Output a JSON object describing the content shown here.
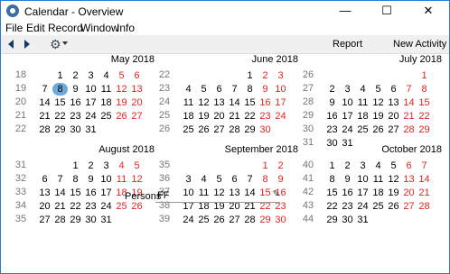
{
  "window": {
    "title": "Calendar - Overview",
    "controls": {
      "minimize": "—",
      "maximize": "☐",
      "close": "✕"
    }
  },
  "menubar": [
    "File",
    "Edit",
    "Record",
    "Window",
    "Info"
  ],
  "toolbar": {
    "report_label": "Report",
    "new_activity_label": "New Activity"
  },
  "colors": {
    "weekend": "#e52321",
    "today": "#6fa8dc",
    "week": "#777777"
  },
  "persons": {
    "label": "Persons",
    "value": "FF"
  },
  "months": [
    {
      "title": "May 2018",
      "today": 8,
      "weeks": [
        {
          "wk": "18",
          "days": [
            "",
            "1",
            "2",
            "3",
            "4",
            "5",
            "6"
          ]
        },
        {
          "wk": "19",
          "days": [
            "7",
            "8",
            "9",
            "10",
            "11",
            "12",
            "13"
          ]
        },
        {
          "wk": "20",
          "days": [
            "14",
            "15",
            "16",
            "17",
            "18",
            "19",
            "20"
          ]
        },
        {
          "wk": "21",
          "days": [
            "21",
            "22",
            "23",
            "24",
            "25",
            "26",
            "27"
          ]
        },
        {
          "wk": "22",
          "days": [
            "28",
            "29",
            "30",
            "31",
            "",
            "",
            ""
          ]
        }
      ]
    },
    {
      "title": "June 2018",
      "weeks": [
        {
          "wk": "22",
          "days": [
            "",
            "",
            "",
            "",
            "1",
            "2",
            "3"
          ]
        },
        {
          "wk": "23",
          "days": [
            "4",
            "5",
            "6",
            "7",
            "8",
            "9",
            "10"
          ]
        },
        {
          "wk": "24",
          "days": [
            "11",
            "12",
            "13",
            "14",
            "15",
            "16",
            "17"
          ]
        },
        {
          "wk": "25",
          "days": [
            "18",
            "19",
            "20",
            "21",
            "22",
            "23",
            "24"
          ]
        },
        {
          "wk": "26",
          "days": [
            "25",
            "26",
            "27",
            "28",
            "29",
            "30",
            ""
          ]
        }
      ]
    },
    {
      "title": "July 2018",
      "weeks": [
        {
          "wk": "26",
          "days": [
            "",
            "",
            "",
            "",
            "",
            "",
            "1"
          ]
        },
        {
          "wk": "27",
          "days": [
            "2",
            "3",
            "4",
            "5",
            "6",
            "7",
            "8"
          ]
        },
        {
          "wk": "28",
          "days": [
            "9",
            "10",
            "11",
            "12",
            "13",
            "14",
            "15"
          ]
        },
        {
          "wk": "29",
          "days": [
            "16",
            "17",
            "18",
            "19",
            "20",
            "21",
            "22"
          ]
        },
        {
          "wk": "30",
          "days": [
            "23",
            "24",
            "25",
            "26",
            "27",
            "28",
            "29"
          ]
        },
        {
          "wk": "31",
          "days": [
            "30",
            "31",
            "",
            "",
            "",
            "",
            ""
          ]
        }
      ]
    },
    {
      "title": "August 2018",
      "weeks": [
        {
          "wk": "31",
          "days": [
            "",
            "",
            "1",
            "2",
            "3",
            "4",
            "5"
          ]
        },
        {
          "wk": "32",
          "days": [
            "6",
            "7",
            "8",
            "9",
            "10",
            "11",
            "12"
          ]
        },
        {
          "wk": "33",
          "days": [
            "13",
            "14",
            "15",
            "16",
            "17",
            "18",
            "19"
          ]
        },
        {
          "wk": "34",
          "days": [
            "20",
            "21",
            "22",
            "23",
            "24",
            "25",
            "26"
          ]
        },
        {
          "wk": "35",
          "days": [
            "27",
            "28",
            "29",
            "30",
            "31",
            "",
            ""
          ]
        }
      ]
    },
    {
      "title": "September 2018",
      "weeks": [
        {
          "wk": "35",
          "days": [
            "",
            "",
            "",
            "",
            "",
            "1",
            "2"
          ]
        },
        {
          "wk": "36",
          "days": [
            "3",
            "4",
            "5",
            "6",
            "7",
            "8",
            "9"
          ]
        },
        {
          "wk": "37",
          "days": [
            "10",
            "11",
            "12",
            "13",
            "14",
            "15",
            "16"
          ]
        },
        {
          "wk": "38",
          "days": [
            "17",
            "18",
            "19",
            "20",
            "21",
            "22",
            "23"
          ]
        },
        {
          "wk": "39",
          "days": [
            "24",
            "25",
            "26",
            "27",
            "28",
            "29",
            "30"
          ]
        }
      ]
    },
    {
      "title": "October 2018",
      "weeks": [
        {
          "wk": "40",
          "days": [
            "1",
            "2",
            "3",
            "4",
            "5",
            "6",
            "7"
          ]
        },
        {
          "wk": "41",
          "days": [
            "8",
            "9",
            "10",
            "11",
            "12",
            "13",
            "14"
          ]
        },
        {
          "wk": "42",
          "days": [
            "15",
            "16",
            "17",
            "18",
            "19",
            "20",
            "21"
          ]
        },
        {
          "wk": "43",
          "days": [
            "22",
            "23",
            "24",
            "25",
            "26",
            "27",
            "28"
          ]
        },
        {
          "wk": "44",
          "days": [
            "29",
            "30",
            "31",
            "",
            "",
            "",
            ""
          ]
        }
      ]
    }
  ]
}
